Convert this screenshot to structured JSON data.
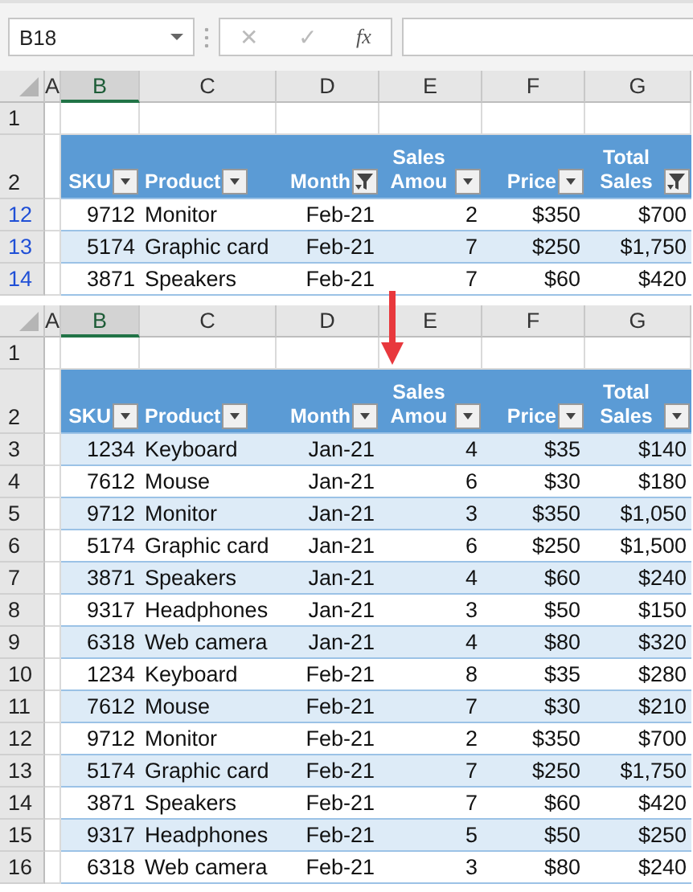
{
  "formula_bar": {
    "name_box": "B18",
    "cancel_symbol": "✕",
    "enter_symbol": "✓",
    "function_symbol": "fx"
  },
  "sheets": [
    {
      "rows_filtered": true,
      "column_letters": [
        {
          "label": "A",
          "selected": false
        },
        {
          "label": "B",
          "selected": true
        },
        {
          "label": "C",
          "selected": false
        },
        {
          "label": "D",
          "selected": false
        },
        {
          "label": "E",
          "selected": false
        },
        {
          "label": "F",
          "selected": false
        },
        {
          "label": "G",
          "selected": false
        }
      ],
      "blank_row": "1",
      "header_row": "2",
      "headers": [
        {
          "label": "SKU",
          "filtered": false
        },
        {
          "label": "Product",
          "filtered": false
        },
        {
          "label": "Month",
          "filtered": true
        },
        {
          "label": "Sales Amou",
          "filtered": false
        },
        {
          "label": "Price",
          "filtered": false
        },
        {
          "label": "Total Sales",
          "filtered": true
        }
      ],
      "rows": [
        {
          "number": "12",
          "shaded": false,
          "cells": [
            "9712",
            "Monitor",
            "Feb-21",
            "2",
            "$350",
            "$700"
          ]
        },
        {
          "number": "13",
          "shaded": true,
          "cells": [
            "5174",
            "Graphic card",
            "Feb-21",
            "7",
            "$250",
            "$1,750"
          ]
        },
        {
          "number": "14",
          "shaded": false,
          "cells": [
            "3871",
            "Speakers",
            "Feb-21",
            "7",
            "$60",
            "$420"
          ]
        }
      ]
    },
    {
      "rows_filtered": false,
      "column_letters": [
        {
          "label": "A",
          "selected": false
        },
        {
          "label": "B",
          "selected": true
        },
        {
          "label": "C",
          "selected": false
        },
        {
          "label": "D",
          "selected": false
        },
        {
          "label": "E",
          "selected": false
        },
        {
          "label": "F",
          "selected": false
        },
        {
          "label": "G",
          "selected": false
        }
      ],
      "blank_row": "1",
      "header_row": "2",
      "headers": [
        {
          "label": "SKU",
          "filtered": false
        },
        {
          "label": "Product",
          "filtered": false
        },
        {
          "label": "Month",
          "filtered": false
        },
        {
          "label": "Sales Amou",
          "filtered": false
        },
        {
          "label": "Price",
          "filtered": false
        },
        {
          "label": "Total Sales",
          "filtered": false
        }
      ],
      "rows": [
        {
          "number": "3",
          "shaded": true,
          "cells": [
            "1234",
            "Keyboard",
            "Jan-21",
            "4",
            "$35",
            "$140"
          ]
        },
        {
          "number": "4",
          "shaded": false,
          "cells": [
            "7612",
            "Mouse",
            "Jan-21",
            "6",
            "$30",
            "$180"
          ]
        },
        {
          "number": "5",
          "shaded": true,
          "cells": [
            "9712",
            "Monitor",
            "Jan-21",
            "3",
            "$350",
            "$1,050"
          ]
        },
        {
          "number": "6",
          "shaded": false,
          "cells": [
            "5174",
            "Graphic card",
            "Jan-21",
            "6",
            "$250",
            "$1,500"
          ]
        },
        {
          "number": "7",
          "shaded": true,
          "cells": [
            "3871",
            "Speakers",
            "Jan-21",
            "4",
            "$60",
            "$240"
          ]
        },
        {
          "number": "8",
          "shaded": false,
          "cells": [
            "9317",
            "Headphones",
            "Jan-21",
            "3",
            "$50",
            "$150"
          ]
        },
        {
          "number": "9",
          "shaded": true,
          "cells": [
            "6318",
            "Web camera",
            "Jan-21",
            "4",
            "$80",
            "$320"
          ]
        },
        {
          "number": "10",
          "shaded": false,
          "cells": [
            "1234",
            "Keyboard",
            "Feb-21",
            "8",
            "$35",
            "$280"
          ]
        },
        {
          "number": "11",
          "shaded": true,
          "cells": [
            "7612",
            "Mouse",
            "Feb-21",
            "7",
            "$30",
            "$210"
          ]
        },
        {
          "number": "12",
          "shaded": false,
          "cells": [
            "9712",
            "Monitor",
            "Feb-21",
            "2",
            "$350",
            "$700"
          ]
        },
        {
          "number": "13",
          "shaded": true,
          "cells": [
            "5174",
            "Graphic card",
            "Feb-21",
            "7",
            "$250",
            "$1,750"
          ]
        },
        {
          "number": "14",
          "shaded": false,
          "cells": [
            "3871",
            "Speakers",
            "Feb-21",
            "7",
            "$60",
            "$420"
          ]
        },
        {
          "number": "15",
          "shaded": true,
          "cells": [
            "9317",
            "Headphones",
            "Feb-21",
            "5",
            "$50",
            "$250"
          ]
        },
        {
          "number": "16",
          "shaded": false,
          "cells": [
            "6318",
            "Web camera",
            "Feb-21",
            "3",
            "$80",
            "$240"
          ]
        }
      ]
    }
  ]
}
